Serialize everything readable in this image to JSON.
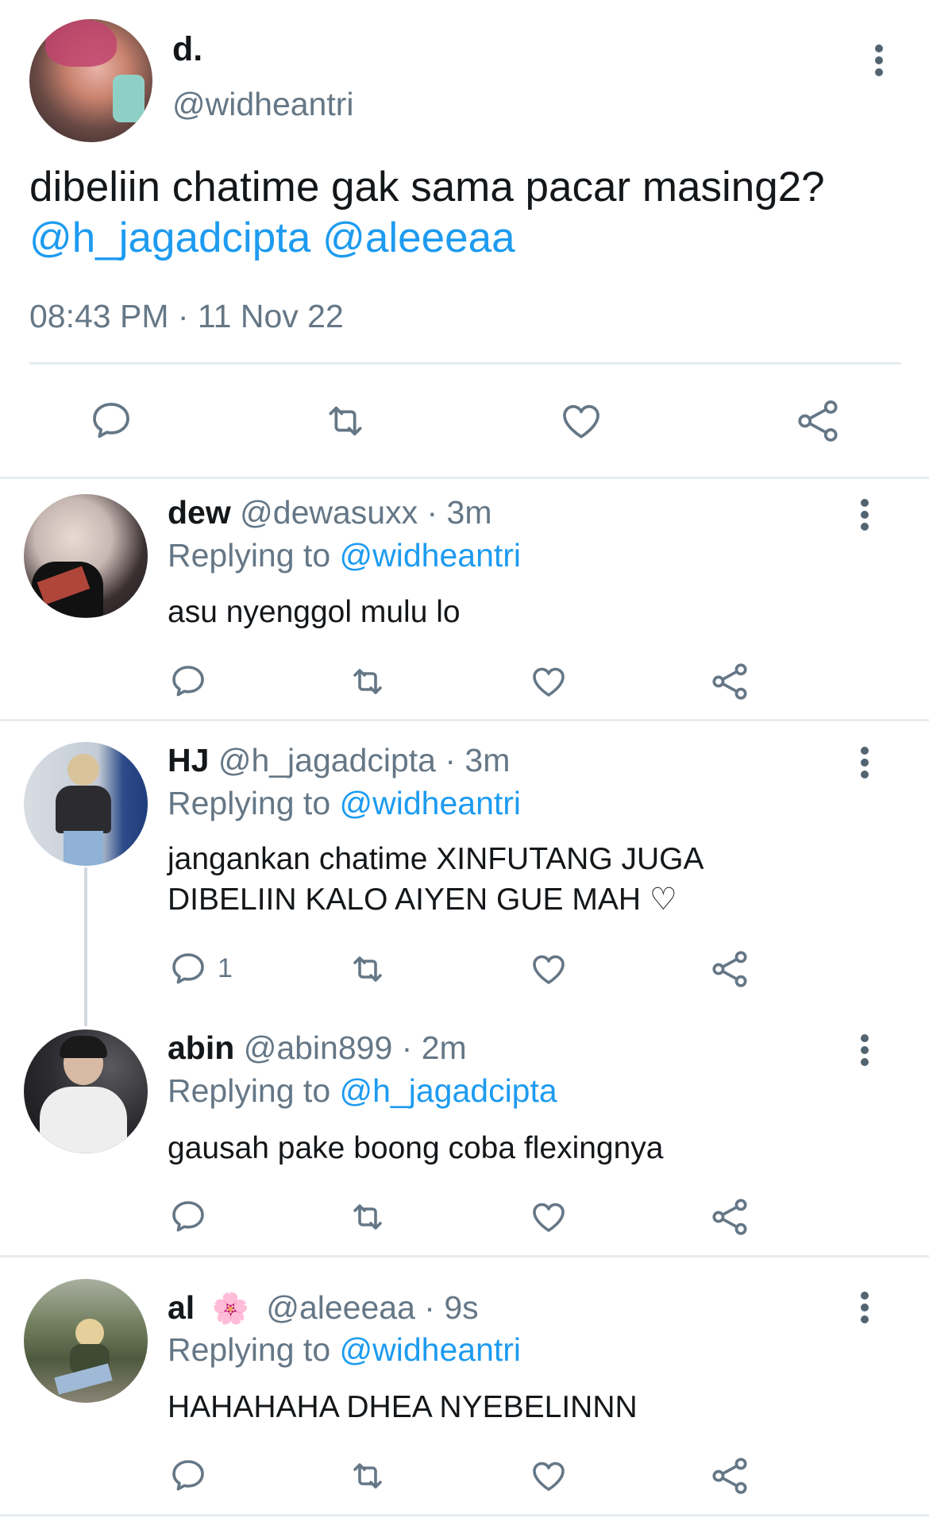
{
  "tweet": {
    "name": "d.",
    "handle": "@widheantri",
    "text_line1": "dibeliin chatime gak sama pacar masing2?",
    "mention1": "@h_jagadcipta",
    "mention2": "@aleeeaa",
    "timestamp": "08:43 PM · 11 Nov 22"
  },
  "replies": [
    {
      "name": "dew",
      "handle": "@dewasuxx",
      "time": "· 3m",
      "replying_prefix": "Replying to",
      "replying_to": "@widheantri",
      "text": "asu nyenggol mulu lo",
      "reply_count": ""
    },
    {
      "name": "HJ",
      "handle": "@h_jagadcipta",
      "time": "· 3m",
      "replying_prefix": "Replying to",
      "replying_to": "@widheantri",
      "text_line1": "jangankan chatime XINFUTANG JUGA",
      "text_line2": "DIBELIIN KALO AIYEN GUE MAH ♡",
      "reply_count": "1"
    },
    {
      "name": "abin",
      "handle": "@abin899",
      "time": "· 2m",
      "replying_prefix": "Replying to",
      "replying_to": "@h_jagadcipta",
      "text": "gausah pake boong coba flexingnya",
      "reply_count": ""
    },
    {
      "name": "al",
      "name_emoji": "🌸",
      "handle": "@aleeeaa",
      "time": "· 9s",
      "replying_prefix": "Replying to",
      "replying_to": "@widheantri",
      "text": "HAHAHAHA DHEA NYEBELINNN",
      "reply_count": ""
    }
  ],
  "icons": {
    "reply": "reply-icon",
    "retweet": "retweet-icon",
    "like": "heart-icon",
    "share": "share-icon",
    "more": "more-vertical-icon"
  },
  "colors": {
    "accent": "#1d9bf0",
    "text": "#14171a",
    "muted": "#657786",
    "divider": "#e6ecf0"
  }
}
